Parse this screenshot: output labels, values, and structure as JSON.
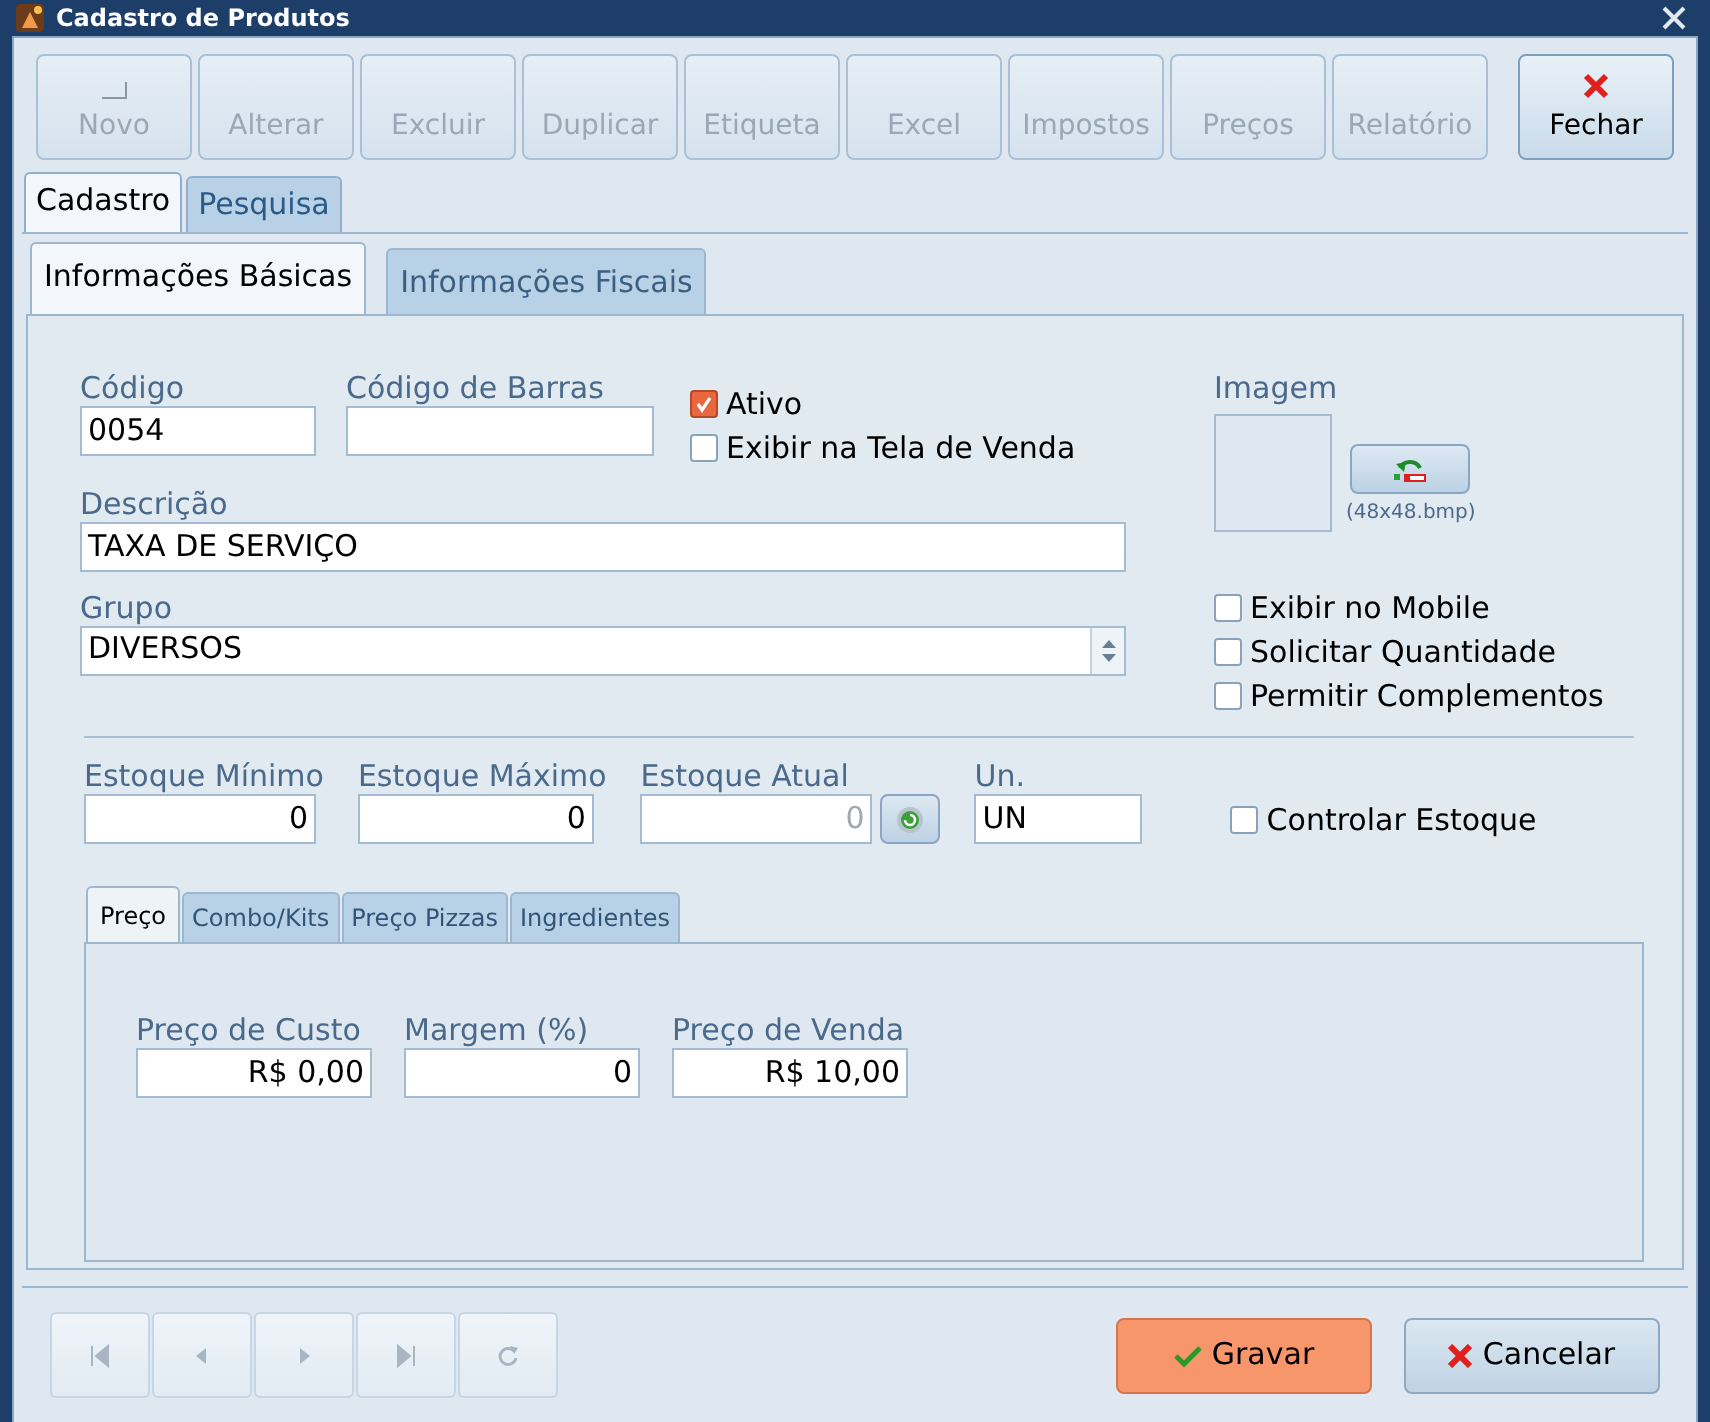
{
  "window": {
    "title": "Cadastro de Produtos"
  },
  "toolbar": [
    {
      "label": "Novo",
      "disabled": true,
      "kind": "new"
    },
    {
      "label": "Alterar",
      "disabled": true,
      "kind": "plain"
    },
    {
      "label": "Excluir",
      "disabled": true,
      "kind": "plain"
    },
    {
      "label": "Duplicar",
      "disabled": true,
      "kind": "plain"
    },
    {
      "label": "Etiqueta",
      "disabled": true,
      "kind": "plain"
    },
    {
      "label": "Excel",
      "disabled": true,
      "kind": "plain"
    },
    {
      "label": "Impostos",
      "disabled": true,
      "kind": "plain"
    },
    {
      "label": "Preços",
      "disabled": true,
      "kind": "plain"
    },
    {
      "label": "Relatório",
      "disabled": true,
      "kind": "plain"
    },
    {
      "label": "Fechar",
      "disabled": false,
      "kind": "close"
    }
  ],
  "tabs": [
    {
      "label": "Cadastro",
      "selected": true
    },
    {
      "label": "Pesquisa",
      "selected": false
    }
  ],
  "subtabs": [
    {
      "label": "Informações Básicas",
      "selected": true
    },
    {
      "label": "Informações Fiscais",
      "selected": false
    }
  ],
  "codigo": {
    "label": "Código",
    "value": "0054"
  },
  "codigo_barras": {
    "label": "Código de Barras"
  },
  "flags": [
    {
      "label": "Ativo",
      "checked": true
    },
    {
      "label": "Exibir na Tela de Venda",
      "checked": false
    }
  ],
  "descricao": {
    "label": "Descrição",
    "value": "TAXA DE SERVIÇO"
  },
  "grupo": {
    "label": "Grupo",
    "value": "DIVERSOS"
  },
  "imagem": {
    "label": "Imagem",
    "hint": "(48x48.bmp)"
  },
  "options": [
    {
      "label": "Exibir no Mobile",
      "checked": false
    },
    {
      "label": "Solicitar Quantidade",
      "checked": false
    },
    {
      "label": "Permitir Complementos",
      "checked": false
    }
  ],
  "estoque": [
    {
      "label": "Estoque Mínimo",
      "value": "0",
      "disabled": false
    },
    {
      "label": "Estoque Máximo",
      "value": "0",
      "disabled": false
    },
    {
      "label": "Estoque Atual",
      "value": "0",
      "disabled": true
    }
  ],
  "unidade": {
    "label": "Un.",
    "value": "UN"
  },
  "controlar_estoque": {
    "label": "Controlar Estoque",
    "checked": false
  },
  "price_tabs": [
    {
      "label": "Preço",
      "selected": true
    },
    {
      "label": "Combo/Kits",
      "selected": false
    },
    {
      "label": "Preço Pizzas",
      "selected": false
    },
    {
      "label": "Ingredientes",
      "selected": false
    }
  ],
  "price_fields": [
    {
      "label": "Preço de Custo",
      "value": "R$ 0,00"
    },
    {
      "label": "Margem (%)",
      "value": "0"
    },
    {
      "label": "Preço de Venda",
      "value": "R$ 10,00"
    }
  ],
  "actions": [
    {
      "label": "Gravar",
      "kind": "save"
    },
    {
      "label": "Cancelar",
      "kind": "cancel"
    }
  ]
}
